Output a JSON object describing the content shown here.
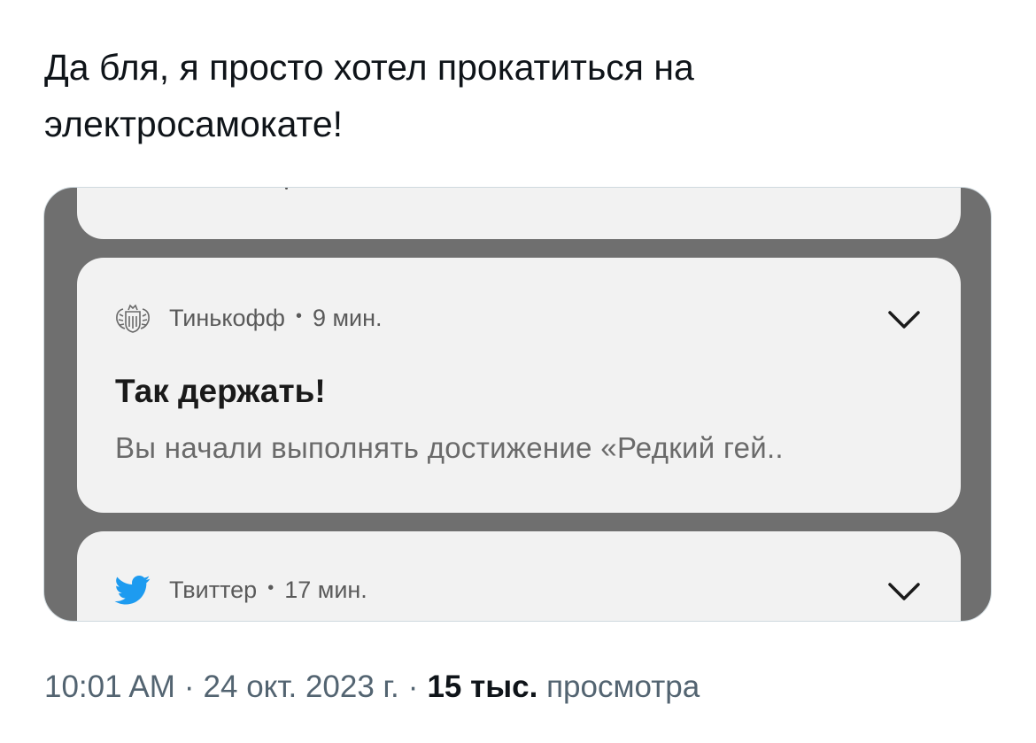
{
  "tweet": {
    "text_line1": "Да бля, я просто хотел прокатиться на",
    "text_line2": "электросамокате!"
  },
  "notifications": [
    {
      "app_name": "Тинькофф",
      "time": "9 мин.",
      "separator": "•",
      "icon": "tinkoff-crest-icon",
      "title": "Так держать!",
      "body": "Вы начали выполнять достижение «Редкий гей.."
    },
    {
      "app_name": "Твиттер",
      "time": "17 мин.",
      "separator": "•",
      "icon": "twitter-bird-icon",
      "icon_color": "#1d9bf0"
    }
  ],
  "meta": {
    "time": "10:01 AM",
    "date": "24 окт. 2023 г.",
    "separator": "·",
    "views_count": "15 тыс.",
    "views_label": "просмотра"
  },
  "colors": {
    "media_background": "#6f6f6f",
    "notification_card": "#f2f2f2",
    "meta_text": "#536471"
  }
}
